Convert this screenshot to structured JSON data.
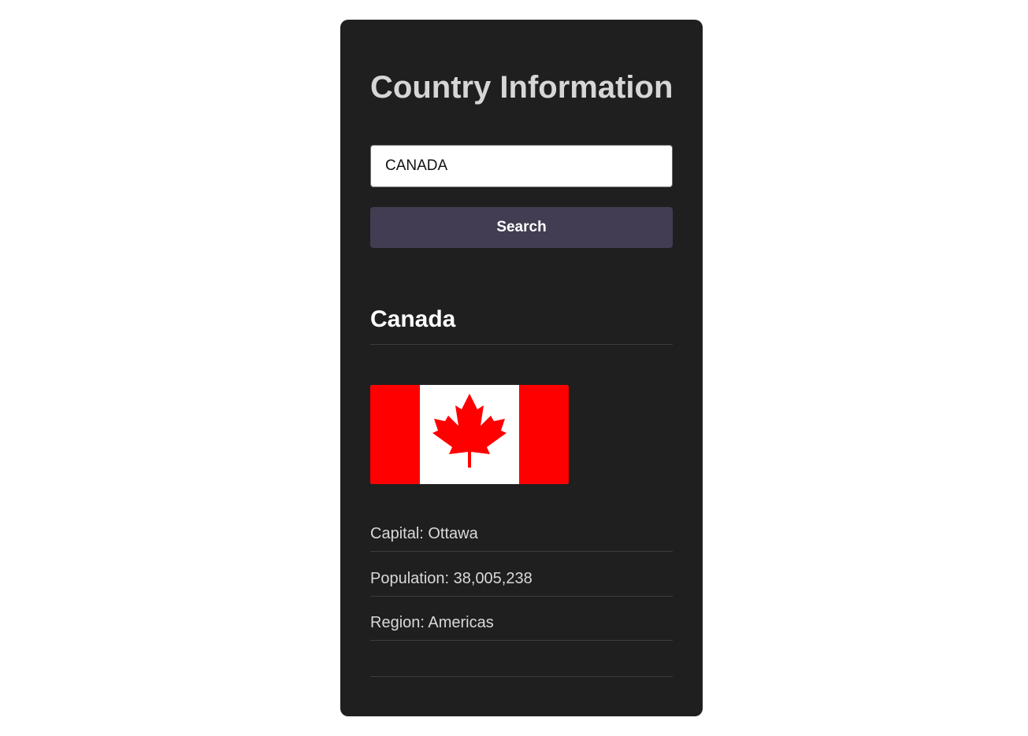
{
  "app": {
    "title": "Country Information"
  },
  "search": {
    "value": "CANADA",
    "button_label": "Search"
  },
  "result": {
    "country_name": "Canada",
    "flag_icon": "canada-flag",
    "colors": {
      "flag_red": "#ff0000",
      "flag_white": "#ffffff"
    },
    "details": [
      {
        "text": "Capital: Ottawa"
      },
      {
        "text": "Population: 38,005,238"
      },
      {
        "text": "Region: Americas"
      }
    ]
  },
  "theme": {
    "card_background": "#1f1f1f",
    "button_background": "#423d52",
    "title_color": "#d6d6d6"
  }
}
